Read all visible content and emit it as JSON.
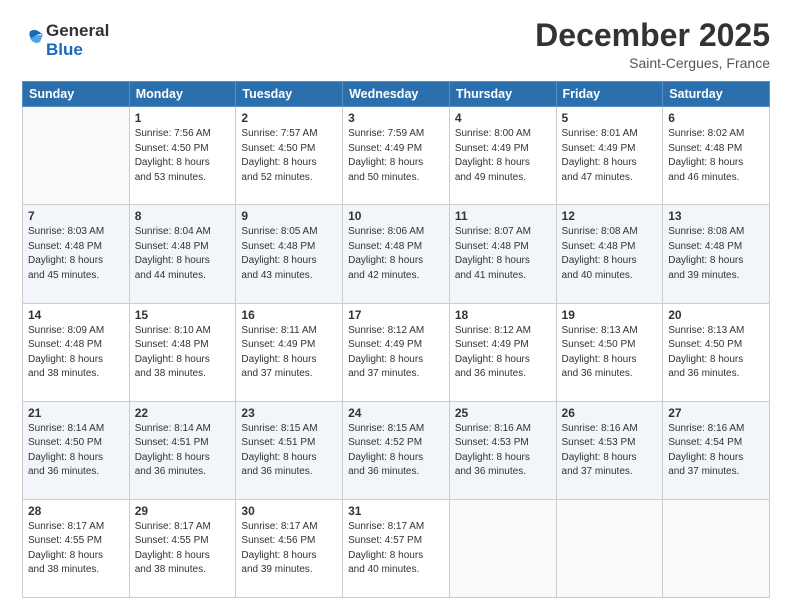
{
  "logo": {
    "general": "General",
    "blue": "Blue"
  },
  "header": {
    "title": "December 2025",
    "subtitle": "Saint-Cergues, France"
  },
  "days": [
    "Sunday",
    "Monday",
    "Tuesday",
    "Wednesday",
    "Thursday",
    "Friday",
    "Saturday"
  ],
  "weeks": [
    [
      {
        "num": "",
        "lines": []
      },
      {
        "num": "1",
        "lines": [
          "Sunrise: 7:56 AM",
          "Sunset: 4:50 PM",
          "Daylight: 8 hours",
          "and 53 minutes."
        ]
      },
      {
        "num": "2",
        "lines": [
          "Sunrise: 7:57 AM",
          "Sunset: 4:50 PM",
          "Daylight: 8 hours",
          "and 52 minutes."
        ]
      },
      {
        "num": "3",
        "lines": [
          "Sunrise: 7:59 AM",
          "Sunset: 4:49 PM",
          "Daylight: 8 hours",
          "and 50 minutes."
        ]
      },
      {
        "num": "4",
        "lines": [
          "Sunrise: 8:00 AM",
          "Sunset: 4:49 PM",
          "Daylight: 8 hours",
          "and 49 minutes."
        ]
      },
      {
        "num": "5",
        "lines": [
          "Sunrise: 8:01 AM",
          "Sunset: 4:49 PM",
          "Daylight: 8 hours",
          "and 47 minutes."
        ]
      },
      {
        "num": "6",
        "lines": [
          "Sunrise: 8:02 AM",
          "Sunset: 4:48 PM",
          "Daylight: 8 hours",
          "and 46 minutes."
        ]
      }
    ],
    [
      {
        "num": "7",
        "lines": [
          "Sunrise: 8:03 AM",
          "Sunset: 4:48 PM",
          "Daylight: 8 hours",
          "and 45 minutes."
        ]
      },
      {
        "num": "8",
        "lines": [
          "Sunrise: 8:04 AM",
          "Sunset: 4:48 PM",
          "Daylight: 8 hours",
          "and 44 minutes."
        ]
      },
      {
        "num": "9",
        "lines": [
          "Sunrise: 8:05 AM",
          "Sunset: 4:48 PM",
          "Daylight: 8 hours",
          "and 43 minutes."
        ]
      },
      {
        "num": "10",
        "lines": [
          "Sunrise: 8:06 AM",
          "Sunset: 4:48 PM",
          "Daylight: 8 hours",
          "and 42 minutes."
        ]
      },
      {
        "num": "11",
        "lines": [
          "Sunrise: 8:07 AM",
          "Sunset: 4:48 PM",
          "Daylight: 8 hours",
          "and 41 minutes."
        ]
      },
      {
        "num": "12",
        "lines": [
          "Sunrise: 8:08 AM",
          "Sunset: 4:48 PM",
          "Daylight: 8 hours",
          "and 40 minutes."
        ]
      },
      {
        "num": "13",
        "lines": [
          "Sunrise: 8:08 AM",
          "Sunset: 4:48 PM",
          "Daylight: 8 hours",
          "and 39 minutes."
        ]
      }
    ],
    [
      {
        "num": "14",
        "lines": [
          "Sunrise: 8:09 AM",
          "Sunset: 4:48 PM",
          "Daylight: 8 hours",
          "and 38 minutes."
        ]
      },
      {
        "num": "15",
        "lines": [
          "Sunrise: 8:10 AM",
          "Sunset: 4:48 PM",
          "Daylight: 8 hours",
          "and 38 minutes."
        ]
      },
      {
        "num": "16",
        "lines": [
          "Sunrise: 8:11 AM",
          "Sunset: 4:49 PM",
          "Daylight: 8 hours",
          "and 37 minutes."
        ]
      },
      {
        "num": "17",
        "lines": [
          "Sunrise: 8:12 AM",
          "Sunset: 4:49 PM",
          "Daylight: 8 hours",
          "and 37 minutes."
        ]
      },
      {
        "num": "18",
        "lines": [
          "Sunrise: 8:12 AM",
          "Sunset: 4:49 PM",
          "Daylight: 8 hours",
          "and 36 minutes."
        ]
      },
      {
        "num": "19",
        "lines": [
          "Sunrise: 8:13 AM",
          "Sunset: 4:50 PM",
          "Daylight: 8 hours",
          "and 36 minutes."
        ]
      },
      {
        "num": "20",
        "lines": [
          "Sunrise: 8:13 AM",
          "Sunset: 4:50 PM",
          "Daylight: 8 hours",
          "and 36 minutes."
        ]
      }
    ],
    [
      {
        "num": "21",
        "lines": [
          "Sunrise: 8:14 AM",
          "Sunset: 4:50 PM",
          "Daylight: 8 hours",
          "and 36 minutes."
        ]
      },
      {
        "num": "22",
        "lines": [
          "Sunrise: 8:14 AM",
          "Sunset: 4:51 PM",
          "Daylight: 8 hours",
          "and 36 minutes."
        ]
      },
      {
        "num": "23",
        "lines": [
          "Sunrise: 8:15 AM",
          "Sunset: 4:51 PM",
          "Daylight: 8 hours",
          "and 36 minutes."
        ]
      },
      {
        "num": "24",
        "lines": [
          "Sunrise: 8:15 AM",
          "Sunset: 4:52 PM",
          "Daylight: 8 hours",
          "and 36 minutes."
        ]
      },
      {
        "num": "25",
        "lines": [
          "Sunrise: 8:16 AM",
          "Sunset: 4:53 PM",
          "Daylight: 8 hours",
          "and 36 minutes."
        ]
      },
      {
        "num": "26",
        "lines": [
          "Sunrise: 8:16 AM",
          "Sunset: 4:53 PM",
          "Daylight: 8 hours",
          "and 37 minutes."
        ]
      },
      {
        "num": "27",
        "lines": [
          "Sunrise: 8:16 AM",
          "Sunset: 4:54 PM",
          "Daylight: 8 hours",
          "and 37 minutes."
        ]
      }
    ],
    [
      {
        "num": "28",
        "lines": [
          "Sunrise: 8:17 AM",
          "Sunset: 4:55 PM",
          "Daylight: 8 hours",
          "and 38 minutes."
        ]
      },
      {
        "num": "29",
        "lines": [
          "Sunrise: 8:17 AM",
          "Sunset: 4:55 PM",
          "Daylight: 8 hours",
          "and 38 minutes."
        ]
      },
      {
        "num": "30",
        "lines": [
          "Sunrise: 8:17 AM",
          "Sunset: 4:56 PM",
          "Daylight: 8 hours",
          "and 39 minutes."
        ]
      },
      {
        "num": "31",
        "lines": [
          "Sunrise: 8:17 AM",
          "Sunset: 4:57 PM",
          "Daylight: 8 hours",
          "and 40 minutes."
        ]
      },
      {
        "num": "",
        "lines": []
      },
      {
        "num": "",
        "lines": []
      },
      {
        "num": "",
        "lines": []
      }
    ]
  ]
}
